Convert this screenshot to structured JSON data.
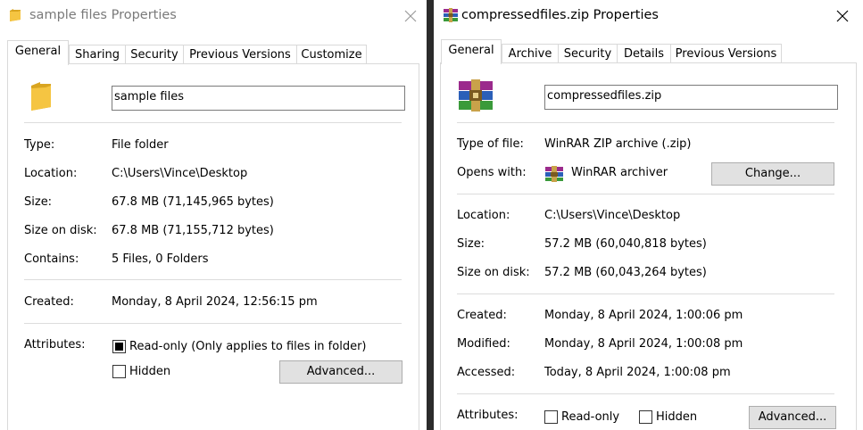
{
  "left_dialog": {
    "title": "sample files Properties",
    "tabs": [
      "General",
      "Sharing",
      "Security",
      "Previous Versions",
      "Customize"
    ],
    "active_tab": 0,
    "name_value": "sample files",
    "props": [
      {
        "label": "Type:",
        "value": "File folder"
      },
      {
        "label": "Location:",
        "value": "C:\\Users\\Vince\\Desktop"
      },
      {
        "label": "Size:",
        "value": "67.8 MB (71,145,965 bytes)"
      },
      {
        "label": "Size on disk:",
        "value": "67.8 MB (71,155,712 bytes)"
      },
      {
        "label": "Contains:",
        "value": "5 Files, 0 Folders"
      }
    ],
    "created": {
      "label": "Created:",
      "value": "Monday, 8 April 2024, 12:56:15 pm"
    },
    "attributes": {
      "label": "Attributes:",
      "readonly_label": "Read-only (Only applies to files in folder)",
      "readonly_checked": true,
      "hidden_label": "Hidden",
      "hidden_checked": false,
      "advanced_label": "Advanced..."
    },
    "icons": {
      "title": "folder-icon",
      "main": "folder-icon"
    },
    "colors": {
      "folder": "#f5c542",
      "title_inactive": "#7a7a7a"
    }
  },
  "right_dialog": {
    "title": "compressedfiles.zip Properties",
    "tabs": [
      "General",
      "Archive",
      "Security",
      "Details",
      "Previous Versions"
    ],
    "active_tab": 0,
    "name_value": "compressedfiles.zip",
    "type": {
      "label": "Type of file:",
      "value": "WinRAR ZIP archive (.zip)"
    },
    "opens": {
      "label": "Opens with:",
      "value": "WinRAR archiver",
      "change_label": "Change..."
    },
    "props": [
      {
        "label": "Location:",
        "value": "C:\\Users\\Vince\\Desktop"
      },
      {
        "label": "Size:",
        "value": "57.2 MB (60,040,818 bytes)"
      },
      {
        "label": "Size on disk:",
        "value": "57.2 MB (60,043,264 bytes)"
      }
    ],
    "dates": [
      {
        "label": "Created:",
        "value": "Monday, 8 April 2024, 1:00:06 pm"
      },
      {
        "label": "Modified:",
        "value": "Monday, 8 April 2024, 1:00:08 pm"
      },
      {
        "label": "Accessed:",
        "value": "Today, 8 April 2024, 1:00:08 pm"
      }
    ],
    "attributes": {
      "label": "Attributes:",
      "readonly_label": "Read-only",
      "readonly_checked": false,
      "hidden_label": "Hidden",
      "hidden_checked": false,
      "advanced_label": "Advanced..."
    },
    "icons": {
      "title": "winrar-archive-icon",
      "main": "winrar-archive-icon",
      "opens": "winrar-icon"
    }
  }
}
